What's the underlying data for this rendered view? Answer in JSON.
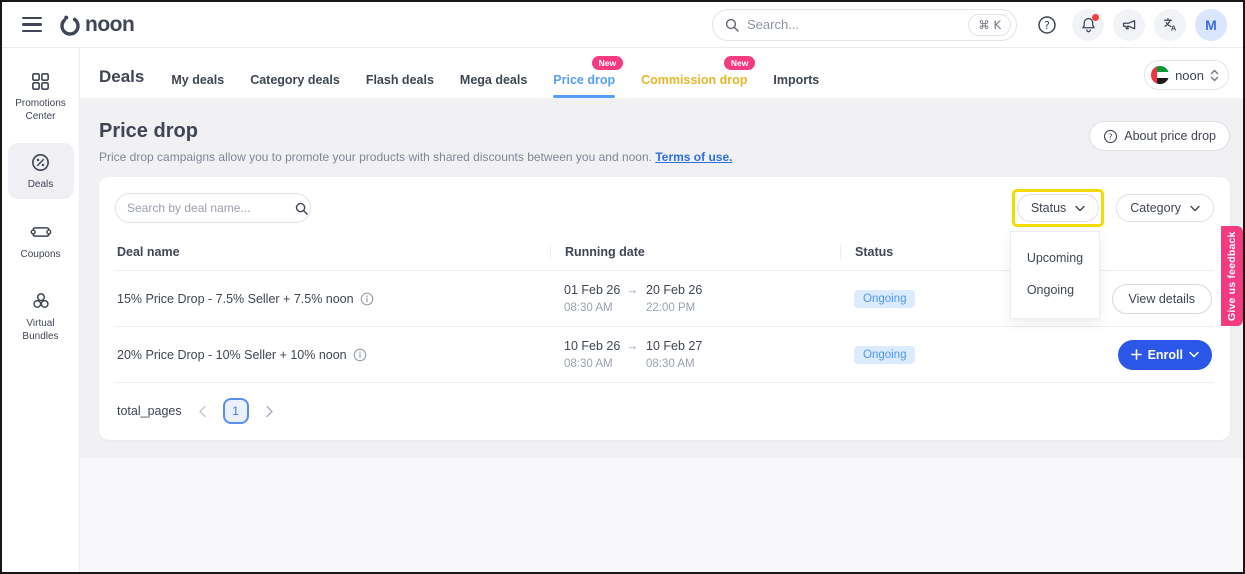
{
  "topbar": {
    "logo_text": "noon",
    "search_placeholder": "Search...",
    "search_shortcut": "⌘ K",
    "avatar_initial": "M"
  },
  "tabbar": {
    "title": "Deals",
    "tabs": [
      {
        "label": "My deals"
      },
      {
        "label": "Category deals"
      },
      {
        "label": "Flash deals"
      },
      {
        "label": "Mega deals"
      },
      {
        "label": "Price drop",
        "badge": "New"
      },
      {
        "label": "Commission drop",
        "badge": "New"
      },
      {
        "label": "Imports"
      }
    ],
    "country_selector_label": "noon"
  },
  "sidebar": {
    "items": [
      {
        "label": "Promotions Center"
      },
      {
        "label": "Deals"
      },
      {
        "label": "Coupons"
      },
      {
        "label": "Virtual Bundles"
      }
    ]
  },
  "page": {
    "title": "Price drop",
    "description": "Price drop campaigns allow you to promote your products with shared discounts between you and noon.",
    "terms_link": "Terms of use.",
    "about_button": "About price drop"
  },
  "filters": {
    "search_placeholder": "Search by deal name...",
    "status_label": "Status",
    "category_label": "Category",
    "status_options": [
      {
        "label": "Upcoming"
      },
      {
        "label": "Ongoing"
      }
    ]
  },
  "table": {
    "headers": {
      "deal_name": "Deal name",
      "running_date": "Running date",
      "status": "Status"
    },
    "rows": [
      {
        "deal_name": "15% Price Drop - 7.5% Seller + 7.5% noon",
        "start_date": "01 Feb 26",
        "end_date": "20 Feb 26",
        "start_time": "08:30 AM",
        "end_time": "22:00 PM",
        "status": "Ongoing",
        "action": "View details"
      },
      {
        "deal_name": "20% Price Drop - 10% Seller + 10% noon",
        "start_date": "10 Feb 26",
        "end_date": "10 Feb 27",
        "start_time": "08:30 AM",
        "end_time": "08:30 AM",
        "status": "Ongoing",
        "action": "Enroll"
      }
    ]
  },
  "pagination": {
    "label": "total_pages",
    "current_page": "1"
  },
  "feedback_tab_label": "Give us feedback",
  "glyphs": {
    "arrow_right": "→"
  },
  "colors": {
    "brand_dark": "#404553",
    "primary_blue": "#2b57e8",
    "active_tab_blue": "#55a0f4",
    "commission_gold": "#e8b62c",
    "noon_pink": "#f43a80",
    "highlight_yellow": "#f4dc00",
    "status_badge_bg": "#dcebfd",
    "status_badge_text": "#4c97f4",
    "content_bg": "#f1f1f4"
  }
}
